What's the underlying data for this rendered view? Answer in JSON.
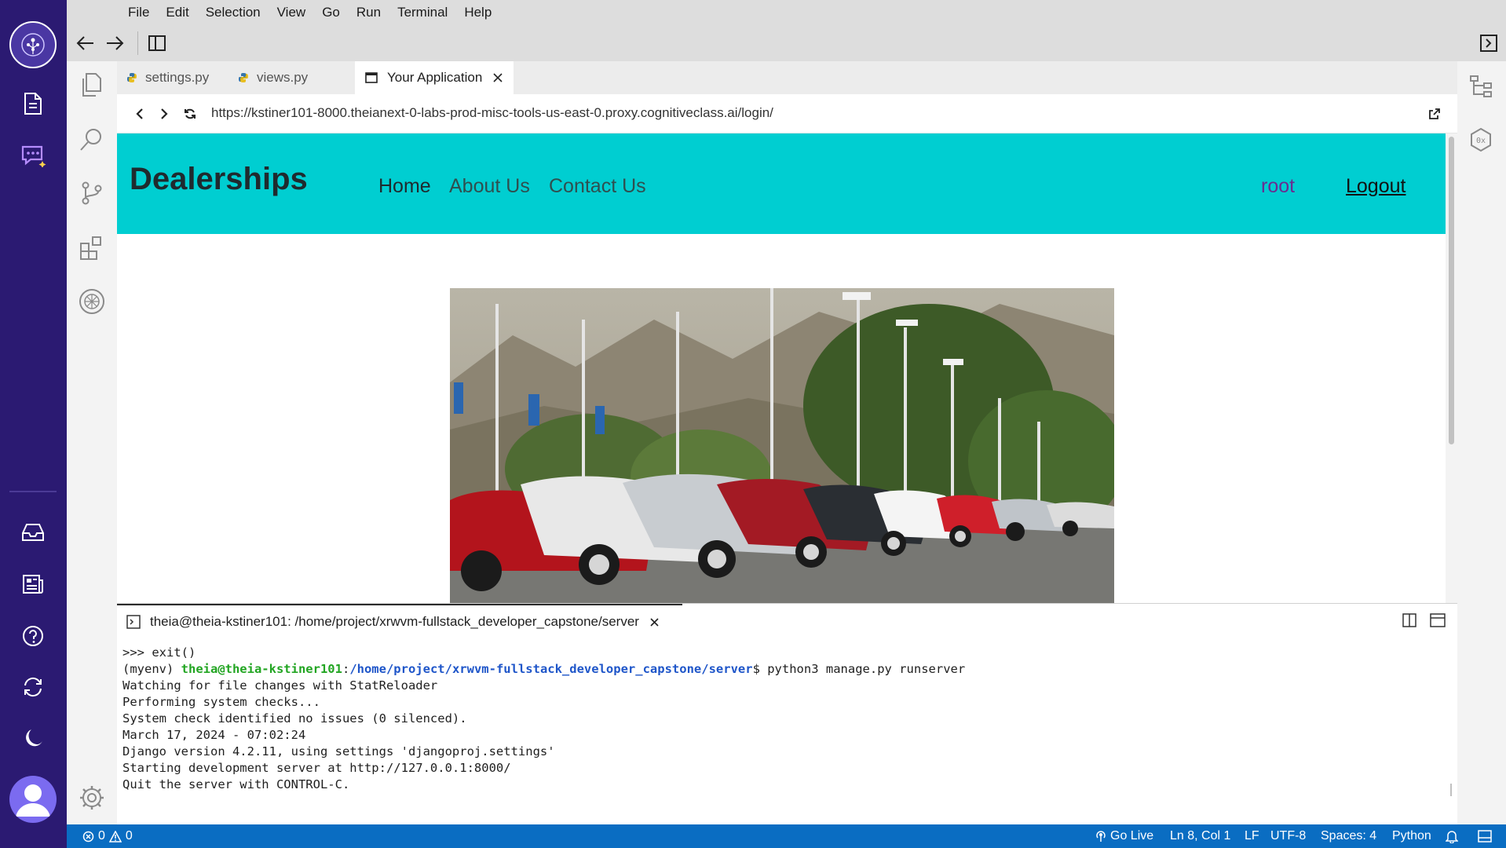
{
  "menu": [
    "File",
    "Edit",
    "Selection",
    "View",
    "Go",
    "Run",
    "Terminal",
    "Help"
  ],
  "tabs": [
    {
      "label": "settings.py",
      "icon": "python-icon"
    },
    {
      "label": "views.py",
      "icon": "python-icon"
    },
    {
      "label": "Your Application",
      "icon": "browser-icon",
      "active": true
    }
  ],
  "browser": {
    "url": "https://kstiner101-8000.theianext-0-labs-prod-misc-tools-us-east-0.proxy.cognitiveclass.ai/login/"
  },
  "site": {
    "brand": "Dealerships",
    "nav": [
      "Home",
      "About Us",
      "Contact Us"
    ],
    "user": "root",
    "logout": "Logout",
    "accent_color": "#00ced1"
  },
  "terminal": {
    "tab_title": "theia@theia-kstiner101: /home/project/xrwvm-fullstack_developer_capstone/server",
    "line1": ">>> exit()",
    "prompt_env": "(myenv) ",
    "prompt_user": "theia@theia-kstiner101",
    "prompt_sep": ":",
    "prompt_path": "/home/project/xrwvm-fullstack_developer_capstone/server",
    "prompt_cmd": "$ python3 manage.py runserver",
    "lines": [
      "Watching for file changes with StatReloader",
      "Performing system checks...",
      "",
      "System check identified no issues (0 silenced).",
      "March 17, 2024 - 07:02:24",
      "Django version 4.2.11, using settings 'djangoproj.settings'",
      "Starting development server at http://127.0.0.1:8000/",
      "Quit the server with CONTROL-C."
    ]
  },
  "status": {
    "errors": "0",
    "warnings": "0",
    "go_live": "Go Live",
    "position": "Ln 8, Col 1",
    "eol": "LF",
    "encoding": "UTF-8",
    "spaces": "Spaces: 4",
    "language": "Python",
    "color": "#0a6dc2"
  }
}
